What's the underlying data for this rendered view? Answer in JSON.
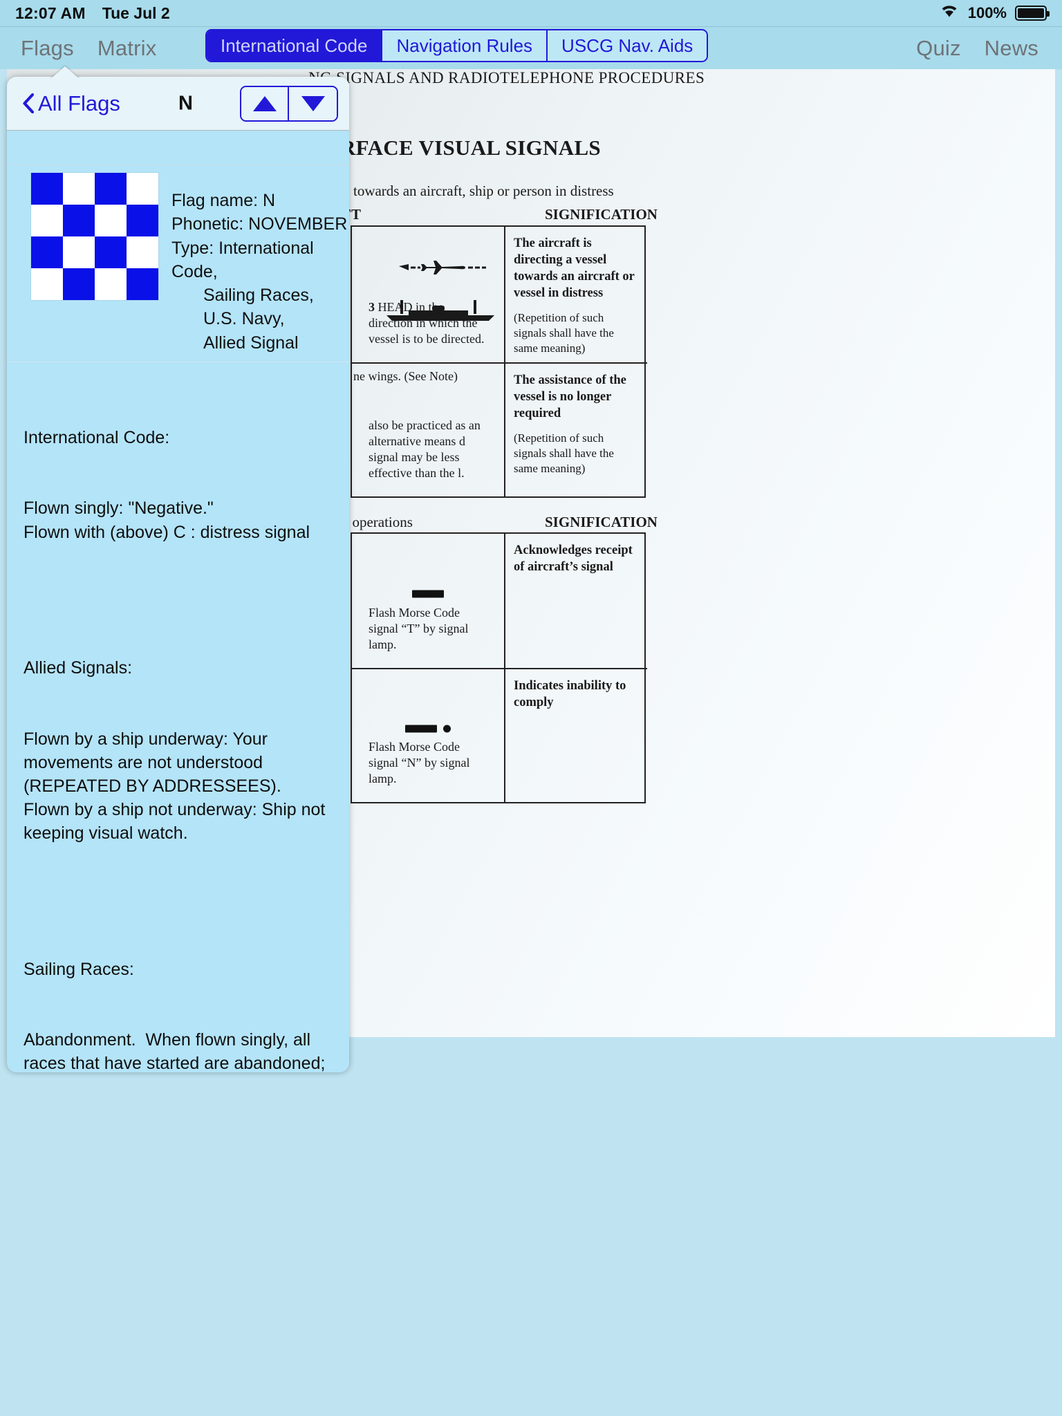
{
  "statusbar": {
    "time": "12:07 AM",
    "date": "Tue Jul 2",
    "battery_percent": "100%",
    "wifi_icon": "wifi-icon",
    "battery_icon": "battery-full-icon"
  },
  "toolbar": {
    "left_items": [
      {
        "label": "Flags"
      },
      {
        "label": "Matrix"
      }
    ],
    "right_items": [
      {
        "label": "Quiz"
      },
      {
        "label": "News"
      }
    ],
    "segments": [
      {
        "label": "International Code",
        "selected": true
      },
      {
        "label": "Navigation Rules",
        "selected": false
      },
      {
        "label": "USCG Nav. Aids",
        "selected": false
      }
    ],
    "accent_color": "#2218d8",
    "bar_color": "#a8dbeb"
  },
  "popover": {
    "back_label": "All Flags",
    "title": "N",
    "prev_icon": "triangle-up-icon",
    "next_icon": "triangle-down-icon",
    "flag": {
      "name_line": "Flag name: N",
      "phonetic_line": "Phonetic: NOVEMBER",
      "type_label": "Type:  International Code,",
      "type_lines": [
        "Sailing Races,",
        "U.S. Navy,",
        "Allied Signal"
      ],
      "colors": {
        "blue": "#0a10e8",
        "white": "#ffffff"
      },
      "pattern": [
        [
          "blue",
          "white",
          "blue",
          "white"
        ],
        [
          "white",
          "blue",
          "white",
          "blue"
        ],
        [
          "blue",
          "white",
          "blue",
          "white"
        ],
        [
          "white",
          "blue",
          "white",
          "blue"
        ]
      ]
    },
    "sections": [
      {
        "heading": "International Code:",
        "body": "Flown singly: \"Negative.\"\nFlown with (above) C : distress signal"
      },
      {
        "heading": "Allied Signals:",
        "body": "Flown by a ship underway: Your movements are not understood (REPEATED BY ADDRESSEES).  Flown by a ship not underway: Ship not keeping visual watch."
      },
      {
        "heading": "Sailing Races:",
        "body": "Abandonment.  When flown singly, all races that have started are abandoned; return to starting area for a new start. The first warning signal will be made 1 minute after N is removed.  When flown with (above) A, means all races are abandoned; no more racing today.  When flown with (above) H, means all races are abandoned; more information ashore."
      }
    ]
  },
  "document": {
    "running_header": "NG SIGNALS AND RADIOTELEPHONE PROCEDURES",
    "section_title": "RFACE VISUAL SIGNALS",
    "intro_1": "irect ships towards an aircraft, ship or person in distress",
    "col_aircraft": "AFT",
    "col_signification_1": "SIGNIFICATION",
    "intro_2": "and rescue operations",
    "col_signification_2": "SIGNIFICATION",
    "table1": [
      {
        "art": "aircraft-over-ship-icon",
        "caption_number": "3",
        "caption": "HEAD in the direction in which the vessel is to be directed.",
        "signification_head": "The aircraft is directing a vessel towards an aircraft or vessel in distress",
        "signification_note": "(Repetition of such signals shall have the same meaning)"
      },
      {
        "art": "wings-note-icon",
        "caption_top": "ne wings. (See Note)",
        "caption": "also be practiced as an alternative means d signal may be less effective than the l.",
        "signification_head": "The assistance of the vessel is no longer required",
        "signification_note": "(Repetition of such signals shall have the same meaning)"
      }
    ],
    "table2": [
      {
        "art": "morse-dash-icon",
        "morse": [
          "dash"
        ],
        "caption": "Flash Morse Code signal “T” by signal lamp.",
        "signification_head": "Acknowledges receipt of aircraft’s signal"
      },
      {
        "art": "morse-dash-dot-icon",
        "morse": [
          "dash",
          "dot"
        ],
        "caption": "Flash Morse Code signal “N” by signal lamp.",
        "signification_head": "Indicates inability to comply"
      }
    ]
  }
}
